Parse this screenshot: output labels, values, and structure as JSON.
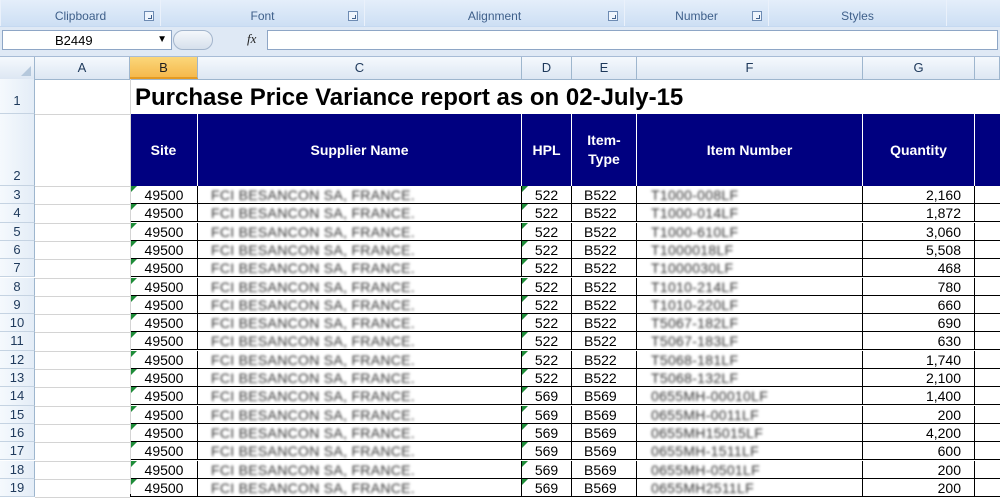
{
  "ribbon": {
    "groups": [
      {
        "label": "Clipboard"
      },
      {
        "label": "Font"
      },
      {
        "label": "Alignment"
      },
      {
        "label": "Number"
      },
      {
        "label": "Styles"
      }
    ]
  },
  "formula_bar": {
    "name_box": "B2449",
    "fx": "fx",
    "formula": ""
  },
  "columns": [
    "A",
    "B",
    "C",
    "D",
    "E",
    "F",
    "G"
  ],
  "selected_column": "B",
  "rows": [
    "1",
    "2",
    "3",
    "4",
    "5",
    "6",
    "7",
    "8",
    "9",
    "10",
    "11",
    "12",
    "13",
    "14",
    "15",
    "16",
    "17",
    "18",
    "19"
  ],
  "sheet": {
    "title": "Purchase Price Variance report as on 02-July-15",
    "headers": {
      "site": "Site",
      "supplier": "Supplier Name",
      "hpl": "HPL",
      "item_type_1": "Item-",
      "item_type_2": "Type",
      "item_number": "Item Number",
      "quantity": "Quantity"
    },
    "data": [
      {
        "site": "49500",
        "supplier": "FCI BESANCON SA, FRANCE.",
        "hpl": "522",
        "type": "B522",
        "item": "T1000-008LF",
        "qty": "2,160"
      },
      {
        "site": "49500",
        "supplier": "FCI BESANCON SA, FRANCE.",
        "hpl": "522",
        "type": "B522",
        "item": "T1000-014LF",
        "qty": "1,872"
      },
      {
        "site": "49500",
        "supplier": "FCI BESANCON SA, FRANCE.",
        "hpl": "522",
        "type": "B522",
        "item": "T1000-610LF",
        "qty": "3,060"
      },
      {
        "site": "49500",
        "supplier": "FCI BESANCON SA, FRANCE.",
        "hpl": "522",
        "type": "B522",
        "item": "T1000018LF",
        "qty": "5,508"
      },
      {
        "site": "49500",
        "supplier": "FCI BESANCON SA, FRANCE.",
        "hpl": "522",
        "type": "B522",
        "item": "T1000030LF",
        "qty": "468"
      },
      {
        "site": "49500",
        "supplier": "FCI BESANCON SA, FRANCE.",
        "hpl": "522",
        "type": "B522",
        "item": "T1010-214LF",
        "qty": "780"
      },
      {
        "site": "49500",
        "supplier": "FCI BESANCON SA, FRANCE.",
        "hpl": "522",
        "type": "B522",
        "item": "T1010-220LF",
        "qty": "660"
      },
      {
        "site": "49500",
        "supplier": "FCI BESANCON SA, FRANCE.",
        "hpl": "522",
        "type": "B522",
        "item": "T5067-182LF",
        "qty": "690"
      },
      {
        "site": "49500",
        "supplier": "FCI BESANCON SA, FRANCE.",
        "hpl": "522",
        "type": "B522",
        "item": "T5067-183LF",
        "qty": "630"
      },
      {
        "site": "49500",
        "supplier": "FCI BESANCON SA, FRANCE.",
        "hpl": "522",
        "type": "B522",
        "item": "T5068-181LF",
        "qty": "1,740"
      },
      {
        "site": "49500",
        "supplier": "FCI BESANCON SA, FRANCE.",
        "hpl": "522",
        "type": "B522",
        "item": "T5068-132LF",
        "qty": "2,100"
      },
      {
        "site": "49500",
        "supplier": "FCI BESANCON SA, FRANCE.",
        "hpl": "569",
        "type": "B569",
        "item": "0655MH-00010LF",
        "qty": "1,400"
      },
      {
        "site": "49500",
        "supplier": "FCI BESANCON SA, FRANCE.",
        "hpl": "569",
        "type": "B569",
        "item": "0655MH-0011LF",
        "qty": "200"
      },
      {
        "site": "49500",
        "supplier": "FCI BESANCON SA, FRANCE.",
        "hpl": "569",
        "type": "B569",
        "item": "0655MH15015LF",
        "qty": "4,200"
      },
      {
        "site": "49500",
        "supplier": "FCI BESANCON SA, FRANCE.",
        "hpl": "569",
        "type": "B569",
        "item": "0655MH-1511LF",
        "qty": "600"
      },
      {
        "site": "49500",
        "supplier": "FCI BESANCON SA, FRANCE.",
        "hpl": "569",
        "type": "B569",
        "item": "0655MH-0501LF",
        "qty": "200"
      },
      {
        "site": "49500",
        "supplier": "FCI BESANCON SA, FRANCE.",
        "hpl": "569",
        "type": "B569",
        "item": "0655MH2511LF",
        "qty": "200"
      }
    ]
  }
}
